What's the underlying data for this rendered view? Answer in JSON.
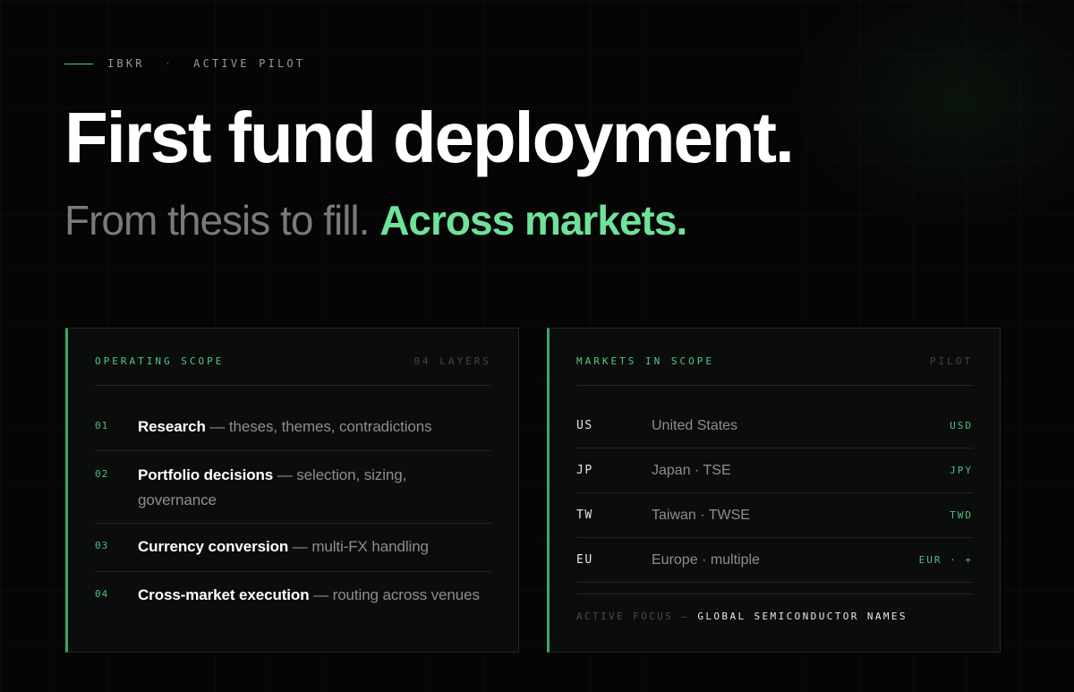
{
  "eyebrow": {
    "broker": "IBKR",
    "separator": "·",
    "status": "ACTIVE PILOT"
  },
  "headline": "First fund deployment.",
  "subhead": {
    "muted": "From thesis to fill.",
    "accent": "Across markets."
  },
  "colors": {
    "accent": "#6fe29a",
    "background": "#050505"
  },
  "operating_scope": {
    "title": "OPERATING SCOPE",
    "meta": "04 LAYERS",
    "items": [
      {
        "num": "01",
        "label": "Research",
        "desc": "— theses, themes, contradictions"
      },
      {
        "num": "02",
        "label": "Portfolio decisions",
        "desc": "— selection, sizing, governance"
      },
      {
        "num": "03",
        "label": "Currency conversion",
        "desc": "— multi-FX handling"
      },
      {
        "num": "04",
        "label": "Cross-market execution",
        "desc": "— routing across venues"
      }
    ]
  },
  "markets": {
    "title": "MARKETS IN SCOPE",
    "meta": "PILOT",
    "rows": [
      {
        "code": "US",
        "name": "United States",
        "currency": "USD"
      },
      {
        "code": "JP",
        "name": "Japan · TSE",
        "currency": "JPY"
      },
      {
        "code": "TW",
        "name": "Taiwan · TWSE",
        "currency": "TWD"
      },
      {
        "code": "EU",
        "name": "Europe · multiple",
        "currency": "EUR · +"
      }
    ],
    "active_focus_label": "ACTIVE FOCUS —",
    "active_focus_value": "GLOBAL SEMICONDUCTOR NAMES"
  }
}
